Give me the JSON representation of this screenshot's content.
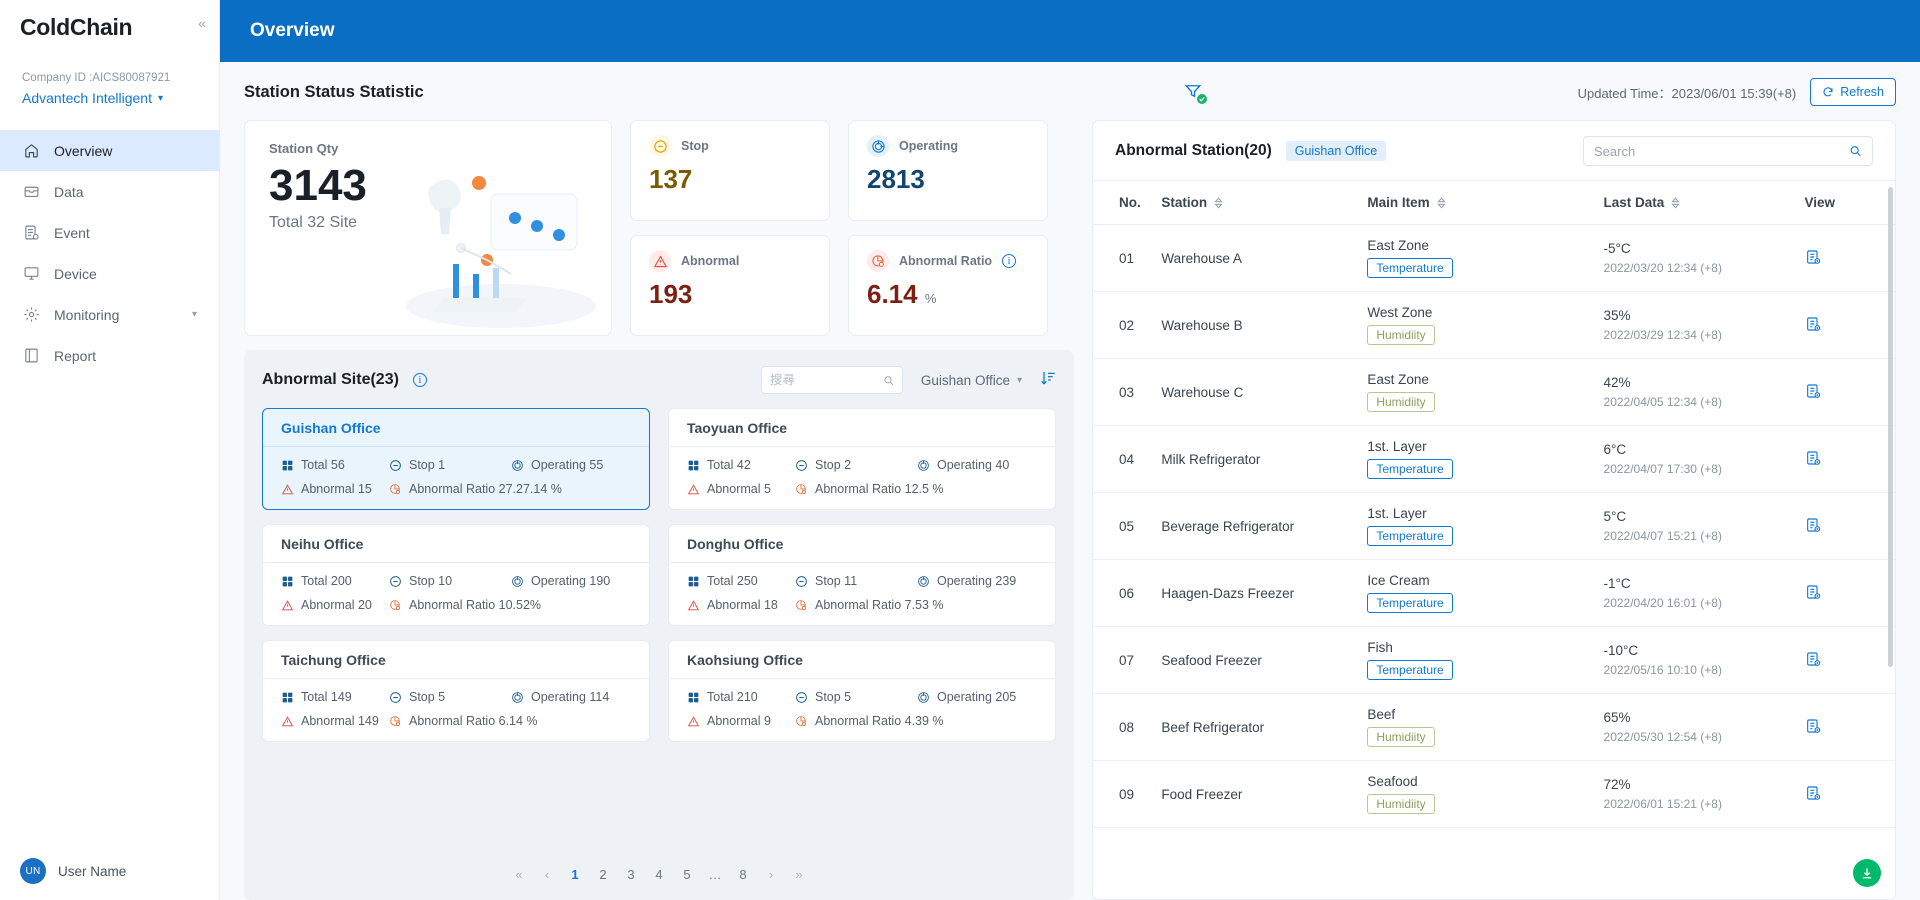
{
  "app": {
    "brand": "ColdChain",
    "collapse": "«"
  },
  "sidebar": {
    "company_id_label": "Company ID :AICS80087921",
    "company_name": "Advantech Intelligent",
    "items": [
      {
        "label": "Overview",
        "icon": "home-icon"
      },
      {
        "label": "Data",
        "icon": "database-icon"
      },
      {
        "label": "Event",
        "icon": "event-icon"
      },
      {
        "label": "Device",
        "icon": "monitor-icon"
      },
      {
        "label": "Monitoring",
        "icon": "gear-icon"
      },
      {
        "label": "Report",
        "icon": "report-icon"
      }
    ],
    "user": {
      "initials": "UN",
      "name": "User Name"
    }
  },
  "header": {
    "title": "Overview"
  },
  "statistic": {
    "section_title": "Station Status Statistic",
    "updated_label": "Updated Time：2023/06/01 15:39(+8)",
    "refresh_label": "Refresh",
    "station_qty": {
      "label": "Station Qty",
      "value": "3143",
      "sub": "Total 32 Site"
    },
    "cards": [
      {
        "label": "Stop",
        "value": "137",
        "suffix": "",
        "icon": "stop-icon"
      },
      {
        "label": "Operating",
        "value": "2813",
        "suffix": "",
        "icon": "operating-icon"
      },
      {
        "label": "Abnormal",
        "value": "193",
        "suffix": "",
        "icon": "abnormal-icon"
      },
      {
        "label": "Abnormal Ratio",
        "value": "6.14",
        "suffix": "%",
        "icon": "abnormal-ratio-icon"
      }
    ]
  },
  "abnormal_site": {
    "title": "Abnormal Site(23)",
    "search_placeholder": "搜尋",
    "office_filter": "Guishan Office",
    "labels": {
      "total": "Total",
      "stop": "Stop",
      "operating": "Operating",
      "abnormal": "Abnormal",
      "ratio": "Abnormal Ratio"
    },
    "cards": [
      {
        "name": "Guishan Office",
        "total": "Total 56",
        "stop": "Stop 1",
        "operating": "Operating 55",
        "abnormal": "Abnormal 15",
        "ratio": "Abnormal Ratio 27.27.14 %",
        "selected": true
      },
      {
        "name": "Taoyuan Office",
        "total": "Total 42",
        "stop": "Stop 2",
        "operating": "Operating 40",
        "abnormal": "Abnormal 5",
        "ratio": "Abnormal Ratio 12.5 %",
        "selected": false
      },
      {
        "name": "Neihu Office",
        "total": "Total 200",
        "stop": "Stop 10",
        "operating": "Operating 190",
        "abnormal": "Abnormal 20",
        "ratio": "Abnormal Ratio 10.52%",
        "selected": false
      },
      {
        "name": "Donghu Office",
        "total": "Total 250",
        "stop": "Stop 11",
        "operating": "Operating 239",
        "abnormal": "Abnormal 18",
        "ratio": "Abnormal Ratio 7.53 %",
        "selected": false
      },
      {
        "name": "Taichung Office",
        "total": "Total 149",
        "stop": "Stop 5",
        "operating": "Operating 114",
        "abnormal": "Abnormal 149",
        "ratio": "Abnormal Ratio 6.14 %",
        "selected": false
      },
      {
        "name": "Kaohsiung Office",
        "total": "Total 210",
        "stop": "Stop 5",
        "operating": "Operating 205",
        "abnormal": "Abnormal 9",
        "ratio": "Abnormal Ratio 4.39 %",
        "selected": false
      }
    ],
    "pagination": {
      "first": "«",
      "prev": "‹",
      "pages": [
        "1",
        "2",
        "3",
        "4",
        "5",
        "…",
        "8"
      ],
      "current": "1",
      "next": "›",
      "last": "»"
    }
  },
  "abnormal_station": {
    "title": "Abnormal Station(20)",
    "chip": "Guishan Office",
    "search_placeholder": "Search",
    "columns": [
      "No.",
      "Station",
      "Main Item",
      "Last Data",
      "View"
    ],
    "rows": [
      {
        "no": "01",
        "station": "Warehouse A",
        "zone": "East Zone",
        "badge": "Temperature",
        "badge_type": "temp",
        "value": "-5°C",
        "time": "2022/03/20 12:34 (+8)"
      },
      {
        "no": "02",
        "station": "Warehouse B",
        "zone": "West Zone",
        "badge": "Humidiity",
        "badge_type": "hum",
        "value": "35%",
        "time": "2022/03/29 12:34 (+8)"
      },
      {
        "no": "03",
        "station": "Warehouse C",
        "zone": "East Zone",
        "badge": "Humidiity",
        "badge_type": "hum",
        "value": "42%",
        "time": "2022/04/05 12:34 (+8)"
      },
      {
        "no": "04",
        "station": "Milk Refrigerator",
        "zone": "1st. Layer",
        "badge": "Temperature",
        "badge_type": "temp",
        "value": "6°C",
        "time": "2022/04/07 17:30 (+8)"
      },
      {
        "no": "05",
        "station": "Beverage Refrigerator",
        "zone": "1st. Layer",
        "badge": "Temperature",
        "badge_type": "temp",
        "value": "5°C",
        "time": "2022/04/07 15:21 (+8)"
      },
      {
        "no": "06",
        "station": "Haagen-Dazs Freezer",
        "zone": "Ice Cream",
        "badge": "Temperature",
        "badge_type": "temp",
        "value": "-1°C",
        "time": "2022/04/20 16:01 (+8)"
      },
      {
        "no": "07",
        "station": "Seafood Freezer",
        "zone": "Fish",
        "badge": "Temperature",
        "badge_type": "temp",
        "value": "-10°C",
        "time": "2022/05/16 10:10 (+8)"
      },
      {
        "no": "08",
        "station": "Beef Refrigerator",
        "zone": "Beef",
        "badge": "Humidiity",
        "badge_type": "hum",
        "value": "65%",
        "time": "2022/05/30 12:54 (+8)"
      },
      {
        "no": "09",
        "station": "Food Freezer",
        "zone": "Seafood",
        "badge": "Humidiity",
        "badge_type": "hum",
        "value": "72%",
        "time": "2022/06/01 15:21 (+8)"
      }
    ]
  },
  "colors": {
    "accent": "#1178d4",
    "topbar": "#0a6ec4",
    "danger": "#7d1f13",
    "warn": "#7a5b00",
    "green": "#00b96b"
  }
}
